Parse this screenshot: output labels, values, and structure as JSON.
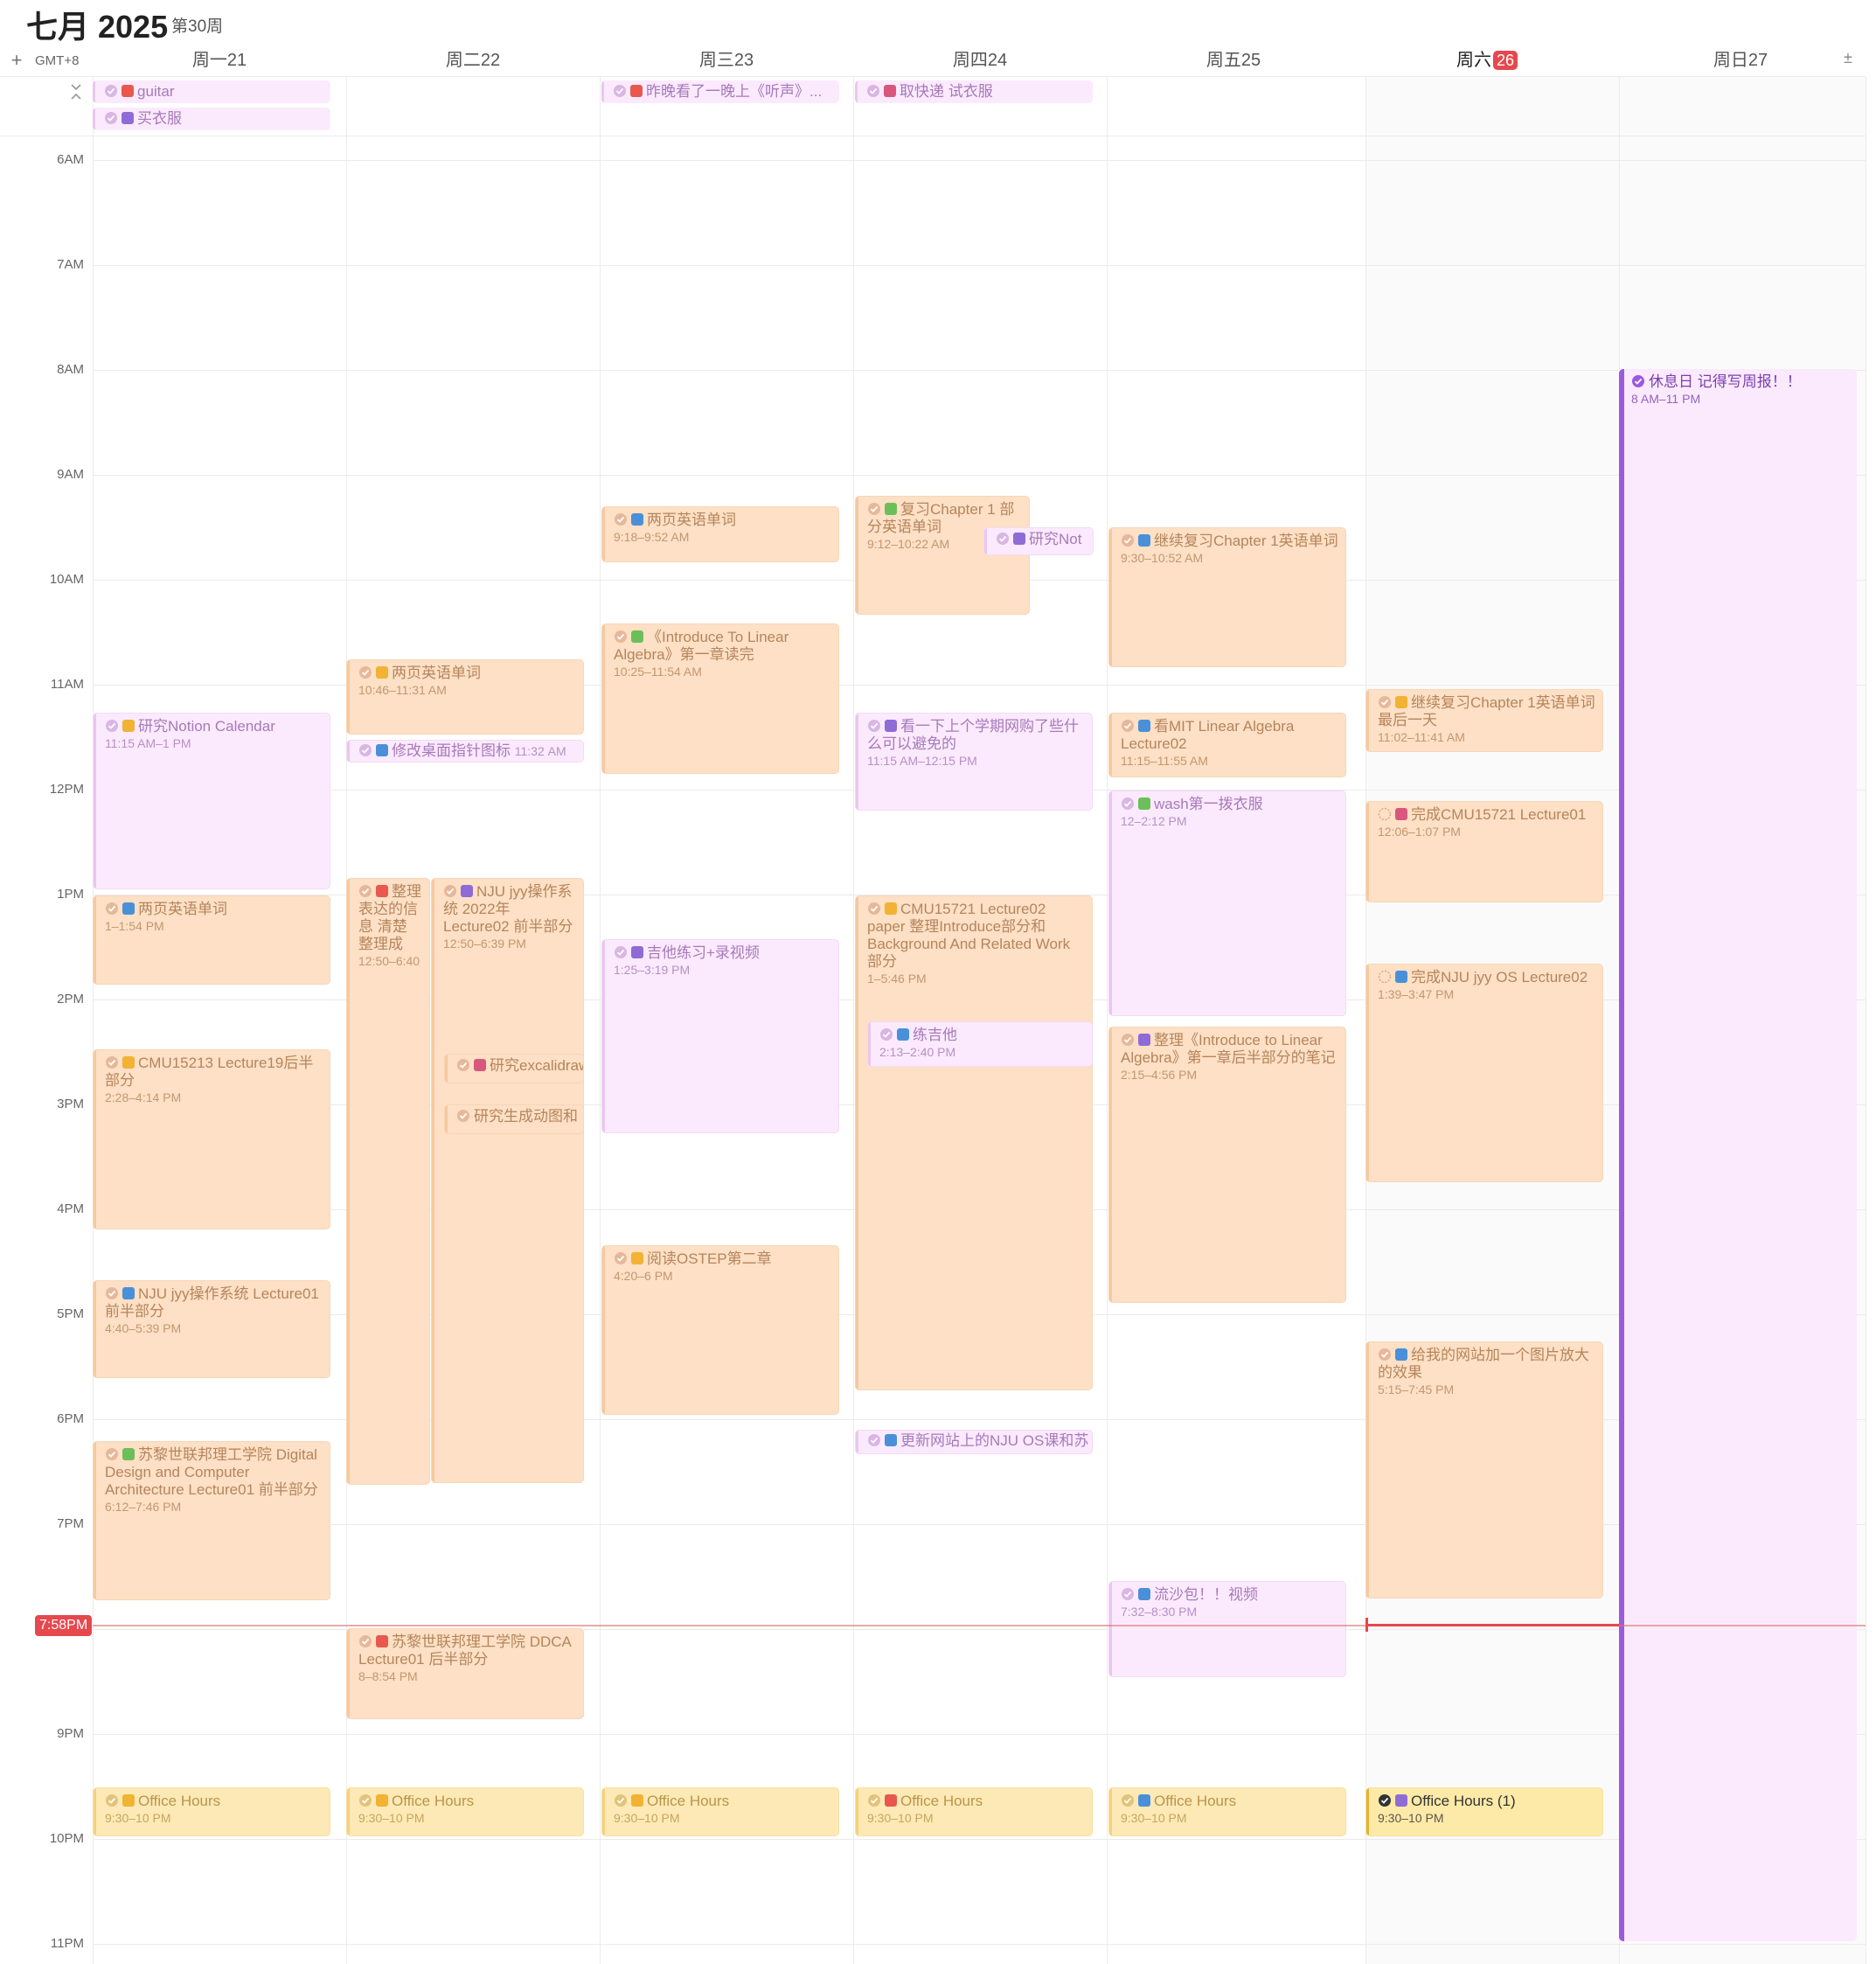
{
  "header": {
    "month_title": "七月 2025",
    "week_label": "第30周",
    "timezone": "GMT+8",
    "add_button": "+",
    "expand_button": "±"
  },
  "days": [
    {
      "label": "周一",
      "num": "21"
    },
    {
      "label": "周二",
      "num": "22"
    },
    {
      "label": "周三",
      "num": "23"
    },
    {
      "label": "周四",
      "num": "24"
    },
    {
      "label": "周五",
      "num": "25"
    },
    {
      "label": "周六",
      "num": "26"
    },
    {
      "label": "周日",
      "num": "27"
    }
  ],
  "hours": [
    "6AM",
    "7AM",
    "8AM",
    "9AM",
    "10AM",
    "11AM",
    "12PM",
    "1PM",
    "2PM",
    "3PM",
    "4PM",
    "5PM",
    "6PM",
    "7PM",
    "8PM",
    "9PM",
    "10PM",
    "11PM"
  ],
  "now_label": "7:58PM",
  "allday": {
    "mon1": "guitar",
    "mon2": "买衣服",
    "wed1": "昨晚看了一晚上《听声》...",
    "thu1": "取快递 试衣服"
  },
  "events": {
    "mon_notion": {
      "title": "研究Notion Calendar",
      "time": "11:15 AM–1 PM"
    },
    "mon_words": {
      "title": "两页英语单词",
      "time": "1–1:54 PM"
    },
    "mon_cmu": {
      "title": "CMU15213 Lecture19后半部分",
      "time": "2:28–4:14 PM"
    },
    "mon_nju": {
      "title": "NJU jyy操作系统 Lecture01 前半部分",
      "time": "4:40–5:39 PM"
    },
    "mon_eth": {
      "title": "苏黎世联邦理工学院 Digital Design and Computer Architecture Lecture01 前半部分",
      "time": "6:12–7:46 PM"
    },
    "mon_oh": {
      "title": "Office Hours",
      "time": "9:30–10 PM"
    },
    "tue_words": {
      "title": "两页英语单词",
      "time": "10:46–11:31 AM"
    },
    "tue_icon": {
      "title": "修改桌面指针图标",
      "time": "11:32 AM"
    },
    "tue_org": {
      "title": "整理 表达的信息 清楚 整理成",
      "time": "12:50–6:40"
    },
    "tue_nju": {
      "title": "NJU jyy操作系统 2022年 Lecture02 前半部分",
      "time": "12:50–6:39 PM"
    },
    "tue_excal": {
      "title": "研究excalidraw"
    },
    "tue_gen": {
      "title": "研究生成动图和"
    },
    "tue_eth": {
      "title": "苏黎世联邦理工学院 DDCA Lecture01 后半部分",
      "time": "8–8:54 PM"
    },
    "tue_oh": {
      "title": "Office Hours",
      "time": "9:30–10 PM"
    },
    "wed_words": {
      "title": "两页英语单词",
      "time": "9:18–9:52 AM"
    },
    "wed_la": {
      "title": "《Introduce To Linear Algebra》第一章读完",
      "time": "10:25–11:54 AM"
    },
    "wed_guitar": {
      "title": "吉他练习+录视频",
      "time": "1:25–3:19 PM"
    },
    "wed_ostep": {
      "title": "阅读OSTEP第二章",
      "time": "4:20–6 PM"
    },
    "wed_oh": {
      "title": "Office Hours",
      "time": "9:30–10 PM"
    },
    "thu_review": {
      "title": "复习Chapter 1 部分英语单词",
      "time": "9:12–10:22 AM"
    },
    "thu_notion": {
      "title": "研究Not"
    },
    "thu_buy": {
      "title": "看一下上个学期网购了些什么可以避免的",
      "time": "11:15 AM–12:15 PM"
    },
    "thu_cmu": {
      "title": "CMU15721 Lecture02 paper 整理Introduce部分和 Background And Related Work 部分",
      "time": "1–5:46 PM"
    },
    "thu_guitar": {
      "title": "练吉他",
      "time": "2:13–2:40 PM"
    },
    "thu_site": {
      "title": "更新网站上的NJU OS课和苏"
    },
    "thu_oh": {
      "title": "Office Hours",
      "time": "9:30–10 PM"
    },
    "fri_review": {
      "title": "继续复习Chapter 1英语单词",
      "time": "9:30–10:52 AM"
    },
    "fri_mit": {
      "title": "看MIT Linear Algebra Lecture02",
      "time": "11:15–11:55 AM"
    },
    "fri_wash": {
      "title": "wash第一拨衣服",
      "time": "12–2:12 PM"
    },
    "fri_la": {
      "title": "整理《Introduce to Linear Algebra》第一章后半部分的笔记",
      "time": "2:15–4:56 PM"
    },
    "fri_video": {
      "title": "流沙包！！视频",
      "time": "7:32–8:30 PM"
    },
    "fri_oh": {
      "title": "Office Hours",
      "time": "9:30–10 PM"
    },
    "sat_review": {
      "title": "继续复习Chapter 1英语单词 最后一天",
      "time": "11:02–11:41 AM"
    },
    "sat_cmu": {
      "title": "完成CMU15721 Lecture01",
      "time": "12:06–1:07 PM"
    },
    "sat_nju": {
      "title": "完成NJU jyy OS Lecture02",
      "time": "1:39–3:47 PM"
    },
    "sat_web": {
      "title": "给我的网站加一个图片放大的效果",
      "time": "5:15–7:45 PM"
    },
    "sat_oh": {
      "title": "Office Hours (1)",
      "time": "9:30–10 PM"
    },
    "sun_rest": {
      "title": "休息日 记得写周报！！",
      "time": "8 AM–11 PM"
    }
  },
  "colors": {
    "orange": "#fde0c5",
    "pink": "#fbeafd",
    "yellow": "#fde9b5",
    "purple": "#9b59e0",
    "now": "#e5484d"
  }
}
